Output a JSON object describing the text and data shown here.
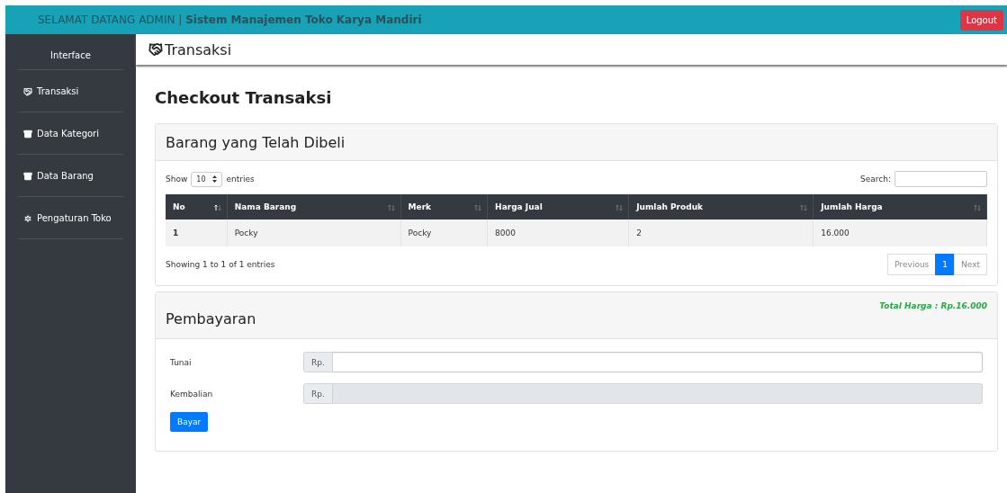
{
  "header": {
    "greeting": "SELAMAT DATANG ADMIN | ",
    "app_name": "Sistem Manajemen Toko Karya Mandiri",
    "logout": "Logout"
  },
  "sidebar": {
    "heading": "Interface",
    "items": [
      {
        "label": "Transaksi",
        "kind": "handshake"
      },
      {
        "label": "Data Kategori",
        "kind": "archive"
      },
      {
        "label": "Data Barang",
        "kind": "archive"
      },
      {
        "label": "Pengaturan Toko",
        "kind": "gear"
      }
    ]
  },
  "page_header": {
    "title": "Transaksi"
  },
  "page_title": "Checkout Transaksi",
  "purchased_card": {
    "title": "Barang yang Telah Dibeli",
    "show_label": "Show",
    "page_size": "10",
    "entries_label": "entries",
    "search_label": "Search:",
    "table": {
      "columns": [
        {
          "label": "No",
          "sorted": true
        },
        {
          "label": "Nama Barang",
          "sorted": false
        },
        {
          "label": "Merk",
          "sorted": false
        },
        {
          "label": "Harga Jual",
          "sorted": false
        },
        {
          "label": "Jumlah Produk",
          "sorted": false
        },
        {
          "label": "Jumlah Harga",
          "sorted": false
        }
      ],
      "rows": [
        [
          "1",
          "Pocky",
          "Pocky",
          "8000",
          "2",
          "16.000"
        ]
      ]
    },
    "info": "Showing 1 to 1 of 1 entries",
    "pagination": [
      {
        "label": "Previous",
        "selected": false,
        "disabled": true
      },
      {
        "label": "1",
        "selected": true,
        "disabled": false
      },
      {
        "label": "Next",
        "selected": false,
        "disabled": true
      }
    ]
  },
  "payment_card": {
    "title": "Pembayaran",
    "total": "Total Harga : Rp.16.000",
    "fields": [
      {
        "label": "Tunai",
        "prefix": "Rp.",
        "disabled": false
      },
      {
        "label": "Kembalian",
        "prefix": "Rp.",
        "disabled": true
      }
    ],
    "submit": "Bayar"
  }
}
